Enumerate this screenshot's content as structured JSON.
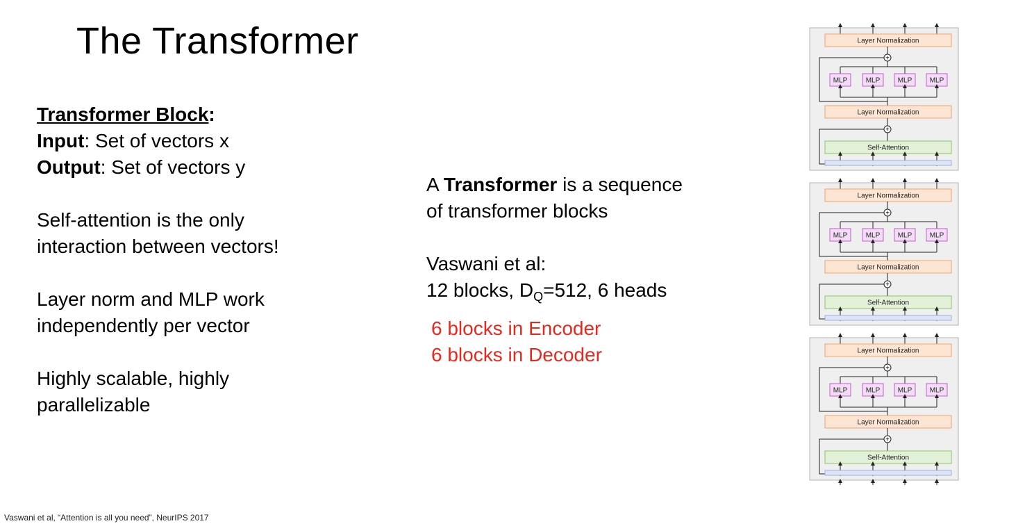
{
  "slide": {
    "title": "The Transformer"
  },
  "left": {
    "heading": "Transformer Block",
    "heading_colon": ":",
    "input_label": "Input",
    "input_text": ": Set of vectors x",
    "output_label": "Output",
    "output_text": ": Set of vectors y",
    "p1_line1": "Self-attention is the only",
    "p1_line2": "interaction between vectors!",
    "p2_line1": "Layer norm and MLP work",
    "p2_line2": "independently per vector",
    "p3_line1": "Highly scalable, highly",
    "p3_line2": "parallelizable"
  },
  "middle": {
    "line1_pre": "A ",
    "line1_bold": "Transformer",
    "line1_post": " is a sequence",
    "line2": "of transformer blocks",
    "ref_line": "Vaswani et al:",
    "spec_pre": "12 blocks, D",
    "spec_sub": "Q",
    "spec_post": "=512, 6 heads",
    "encoder": "6 blocks in Encoder",
    "decoder": "6 blocks in Decoder"
  },
  "footnote": "Vaswani et al, “Attention is all you need”, NeurIPS 2017",
  "diagram": {
    "layer_norm_label": "Layer Normalization",
    "mlp_label": "MLP",
    "self_attention_label": "Self-Attention",
    "plus_symbol": "+",
    "colors": {
      "block_bg": "#efefef",
      "block_border": "#b0b0b0",
      "layer_norm_fill": "#fce5d3",
      "layer_norm_stroke": "#f2a36b",
      "mlp_fill": "#f3dcf5",
      "mlp_stroke": "#c45bd0",
      "attention_fill": "#e2f1d8",
      "attention_stroke": "#8cc46a",
      "input_bar_fill": "#dde4f6",
      "input_bar_stroke": "#9fb0dd"
    }
  }
}
